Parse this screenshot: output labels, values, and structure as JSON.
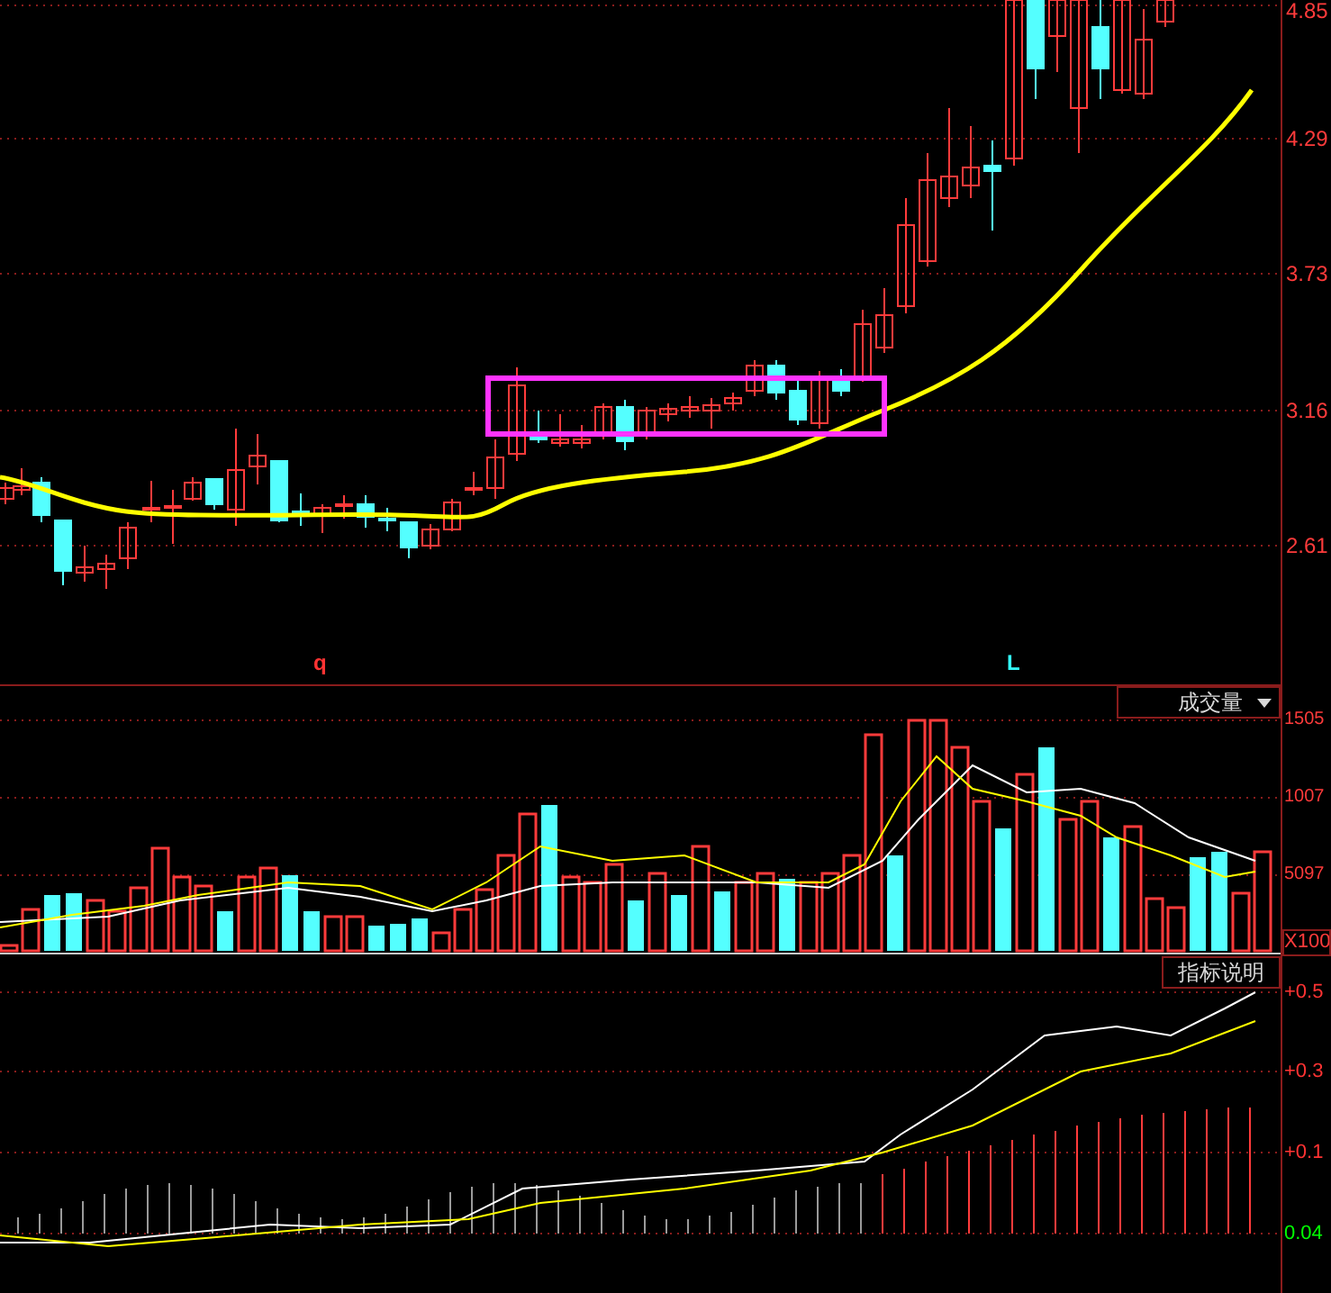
{
  "price_panel": {
    "axis_labels": [
      "4.85",
      "4.29",
      "3.73",
      "3.16",
      "2.61"
    ],
    "markers": [
      {
        "text": "q",
        "color": "#ff3333"
      },
      {
        "text": "L",
        "color": "#33ffff"
      }
    ]
  },
  "volume_panel": {
    "indicator_select": {
      "label": "成交量"
    },
    "axis_labels": [
      "1505",
      "1007",
      "5097"
    ],
    "unit": "X100"
  },
  "indicator_panel": {
    "button": "指标说明",
    "axis_labels": [
      {
        "text": "+0.5",
        "color": "#ff3333"
      },
      {
        "text": "+0.3",
        "color": "#ff3333"
      },
      {
        "text": "+0.1",
        "color": "#ff3333"
      },
      {
        "text": "0.04",
        "color": "#00ff00"
      }
    ]
  }
}
